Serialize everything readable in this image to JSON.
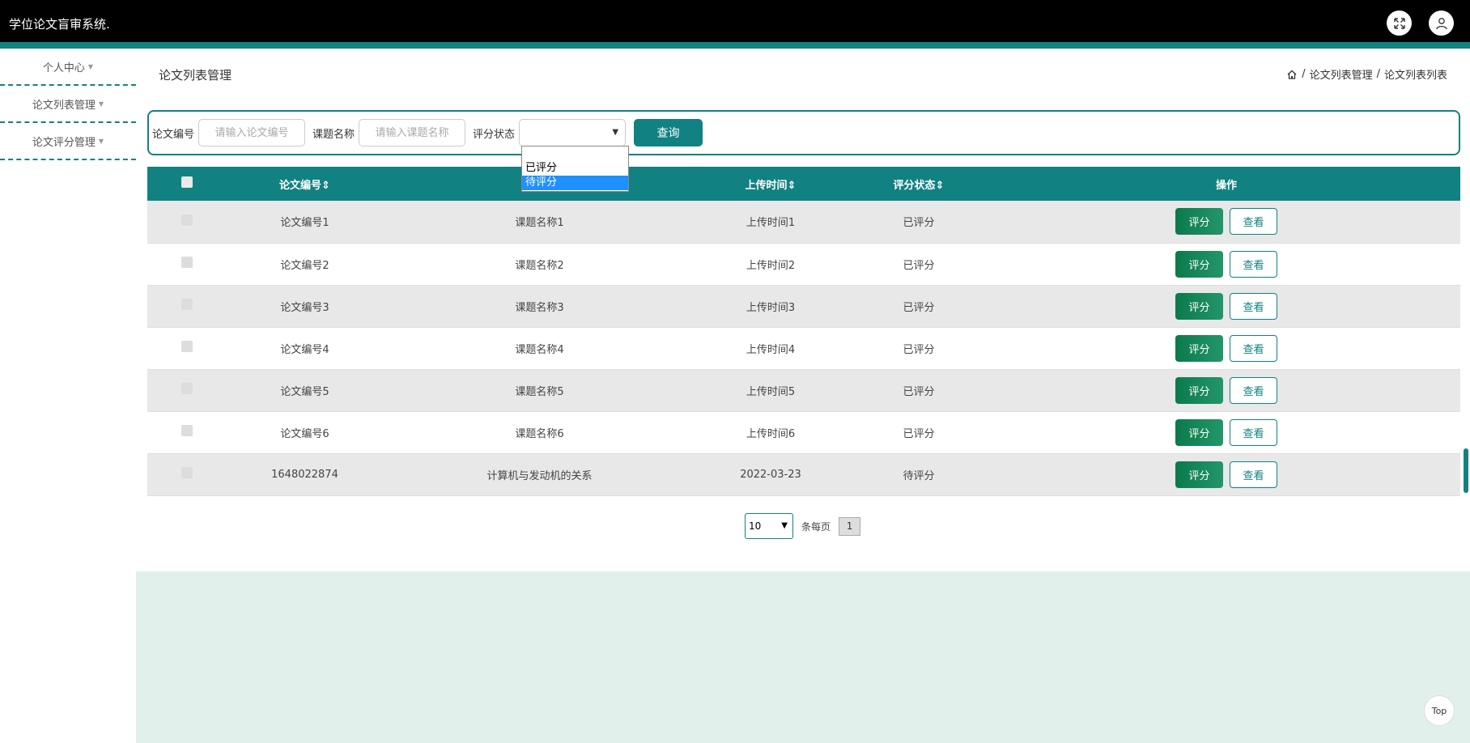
{
  "header": {
    "app_title": "学位论文盲审系统.",
    "fullscreen_icon": "expand-icon",
    "user_icon": "user-icon"
  },
  "sidebar": {
    "items": [
      {
        "label": "个人中心"
      },
      {
        "label": "论文列表管理"
      },
      {
        "label": "论文评分管理"
      }
    ]
  },
  "main": {
    "page_title": "论文列表管理",
    "breadcrumb": [
      "论文列表管理",
      "论文列表列表"
    ]
  },
  "search": {
    "paper_no_label": "论文编号",
    "paper_no_placeholder": "请输入论文编号",
    "topic_label": "课题名称",
    "topic_placeholder": "请输入课题名称",
    "status_label": "评分状态",
    "status_value": "",
    "status_options": [
      "",
      "已评分",
      "待评分"
    ],
    "highlighted_option": "待评分",
    "query_label": "查询"
  },
  "table": {
    "headers": [
      "论文编号",
      "上传时间",
      "评分状态",
      "操作"
    ],
    "rows": [
      {
        "paper_no": "论文编号1",
        "topic": "课题名称1",
        "upload_time": "上传时间1",
        "status": "已评分"
      },
      {
        "paper_no": "论文编号2",
        "topic": "课题名称2",
        "upload_time": "上传时间2",
        "status": "已评分"
      },
      {
        "paper_no": "论文编号3",
        "topic": "课题名称3",
        "upload_time": "上传时间3",
        "status": "已评分"
      },
      {
        "paper_no": "论文编号4",
        "topic": "课题名称4",
        "upload_time": "上传时间4",
        "status": "已评分"
      },
      {
        "paper_no": "论文编号5",
        "topic": "课题名称5",
        "upload_time": "上传时间5",
        "status": "已评分"
      },
      {
        "paper_no": "论文编号6",
        "topic": "课题名称6",
        "upload_time": "上传时间6",
        "status": "已评分"
      },
      {
        "paper_no": "1648022874",
        "topic": "计算机与发动机的关系",
        "upload_time": "2022-03-23",
        "status": "待评分"
      }
    ],
    "score_button": "评分",
    "view_button": "查看"
  },
  "pagination": {
    "page_size": "10",
    "per_page_label": "条每页",
    "current_page": "1"
  },
  "top_button": "Top",
  "colors": {
    "accent": "#128181",
    "score_button": "#0b7a4b",
    "header_bg": "#000000",
    "footer_bg": "#e2f0ec"
  }
}
